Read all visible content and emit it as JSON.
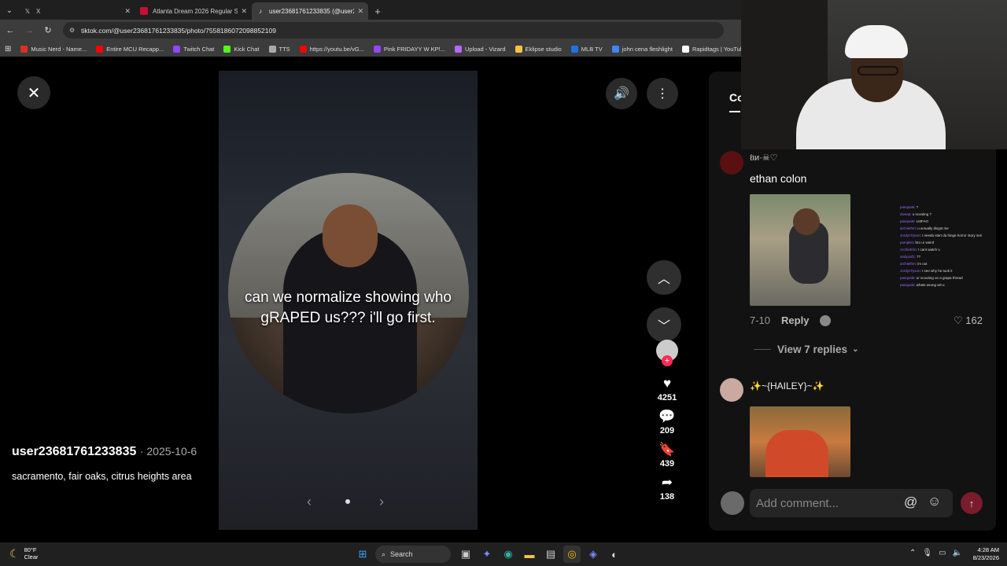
{
  "browser": {
    "tabs": [
      {
        "label": "X",
        "icon": "x-logo-icon",
        "active": false
      },
      {
        "label": "Atlanta Dream 2026 Regular Se",
        "icon": "atlanta-dream-icon",
        "active": false
      },
      {
        "label": "user23681761233835 (@user2",
        "icon": "tiktok-icon",
        "active": true
      }
    ],
    "url": "tiktok.com/@user23681761233835/photo/7558186072098852109",
    "bookmarks": [
      {
        "label": "Music Nerd - Name...",
        "color": "#d93025"
      },
      {
        "label": "Entire MCU Recapp...",
        "color": "#ff0000"
      },
      {
        "label": "Twitch Chat",
        "color": "#9146ff"
      },
      {
        "label": "Kick Chat",
        "color": "#53fc18"
      },
      {
        "label": "TTS",
        "color": "#aaaaaa"
      },
      {
        "label": "https://youtu.be/vG...",
        "color": "#ff0000"
      },
      {
        "label": "Pink FRIDAYY W KP!...",
        "color": "#9146ff"
      },
      {
        "label": "Upload - Vizard",
        "color": "#b06bff"
      },
      {
        "label": "Eklipse studio",
        "color": "#f6c344"
      },
      {
        "label": "MLB TV",
        "color": "#1a73e8"
      },
      {
        "label": "john cena fleshlight",
        "color": "#4285f4"
      },
      {
        "label": "Rapidtags | YouTub...",
        "color": "#ffffff"
      }
    ]
  },
  "post": {
    "caption": "can we normalize showing who gRAPED us??? i'll go first.",
    "author": "user23681761233835",
    "date": "· 2025-10-6",
    "description": "sacramento, fair oaks, citrus heights area",
    "likes": "4251",
    "comments": "209",
    "saves": "439",
    "shares": "138"
  },
  "comments_panel": {
    "tab_label": "Co",
    "comments": [
      {
        "user": "ℓιи·☠♡",
        "text": "ethan colon",
        "time": "7-10",
        "reply_label": "Reply",
        "likes": "162",
        "view_replies": "View 7 replies"
      },
      {
        "user": "✨~{HAILEY}~✨"
      }
    ],
    "add_comment_placeholder": "Add comment..."
  },
  "chat_overlay": [
    {
      "user": "pasquale",
      "msg": ": ?"
    },
    {
      "user": "duwap",
      "msg": ": u scouting ?"
    },
    {
      "user": "pasquale",
      "msg": ": LMFAO"
    },
    {
      "user": "archiethm",
      "msg": ": u actually disgst me"
    },
    {
      "user": "JordynTyson",
      "msg": ": I needa start da hinge horror story seri"
    },
    {
      "user": "pumpkin",
      "msg": ": bro ur weird"
    },
    {
      "user": "ArchieElm",
      "msg": ": I cant watch u"
    },
    {
      "user": "andy1af1",
      "msg": ": ??"
    },
    {
      "user": "archiethm",
      "msg": ": im out"
    },
    {
      "user": "JordynTyson",
      "msg": ": I see why he took it"
    },
    {
      "user": "pasquale",
      "msg": ": ur scouting on a grapa thread"
    },
    {
      "user": "pasquale",
      "msg": ": whats wrong wit u"
    }
  ],
  "taskbar": {
    "temp": "80°F",
    "condition": "Clear",
    "search_label": "Search",
    "time": "4:28 AM",
    "date": "8/23/2026"
  }
}
